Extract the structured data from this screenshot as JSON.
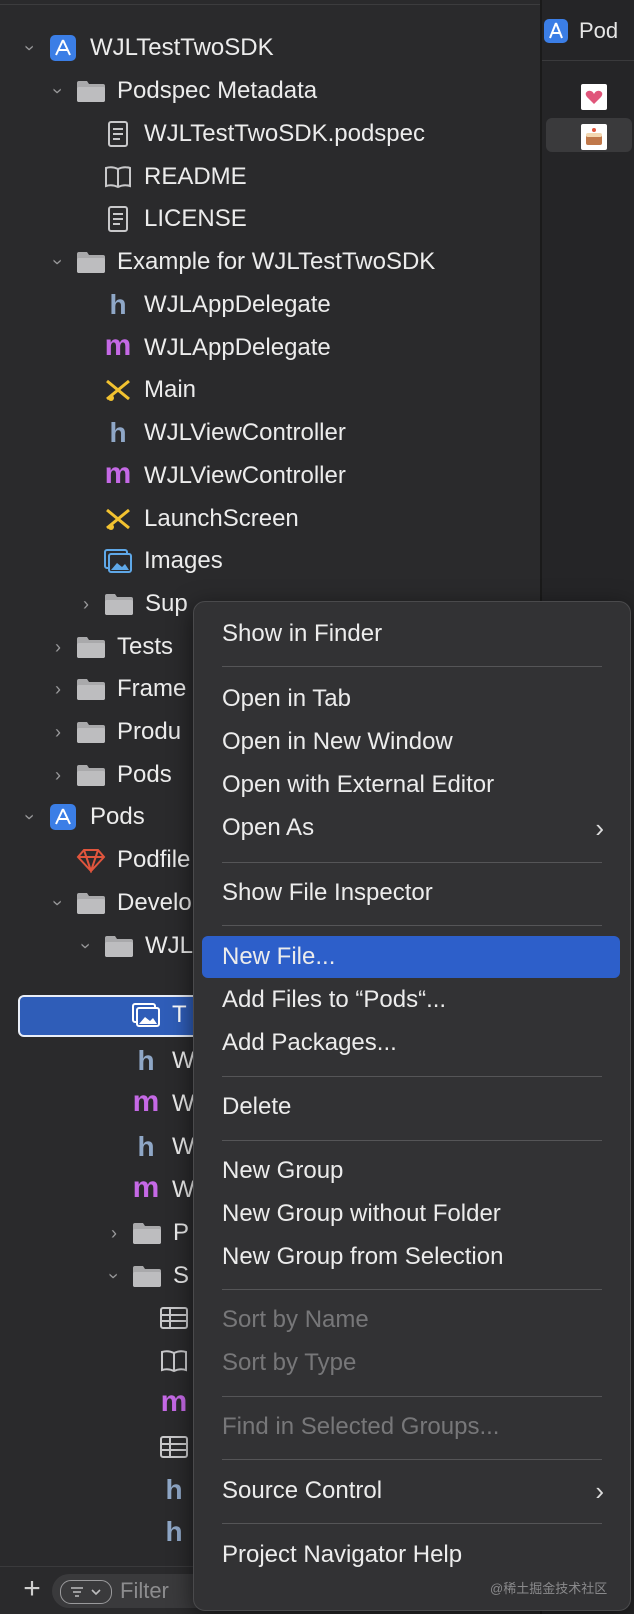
{
  "navigator": {
    "rows": [
      {
        "label": "WJLTestTwoSDK",
        "icon": "xcode-project-icon"
      },
      {
        "label": "Podspec Metadata",
        "icon": "folder-icon"
      },
      {
        "label": "WJLTestTwoSDK.podspec",
        "icon": "document-icon"
      },
      {
        "label": "README",
        "icon": "book-icon"
      },
      {
        "label": "LICENSE",
        "icon": "document-icon"
      },
      {
        "label": "Example for WJLTestTwoSDK",
        "icon": "folder-icon"
      },
      {
        "label": "WJLAppDelegate",
        "icon": "header-h-icon",
        "glyph": "h"
      },
      {
        "label": "WJLAppDelegate",
        "icon": "objc-m-icon",
        "glyph": "m"
      },
      {
        "label": "Main",
        "icon": "storyboard-icon"
      },
      {
        "label": "WJLViewController",
        "icon": "header-h-icon",
        "glyph": "h"
      },
      {
        "label": "WJLViewController",
        "icon": "objc-m-icon",
        "glyph": "m"
      },
      {
        "label": "LaunchScreen",
        "icon": "storyboard-icon"
      },
      {
        "label": "Images",
        "icon": "asset-catalog-icon"
      },
      {
        "label": "Sup",
        "icon": "folder-icon"
      },
      {
        "label": "Tests",
        "icon": "folder-icon"
      },
      {
        "label": "Frame",
        "icon": "folder-icon"
      },
      {
        "label": "Produ",
        "icon": "folder-icon"
      },
      {
        "label": "Pods",
        "icon": "folder-icon"
      },
      {
        "label": "Pods",
        "icon": "xcode-project-icon"
      },
      {
        "label": "Podfile",
        "icon": "ruby-icon"
      },
      {
        "label": "Develo",
        "icon": "folder-icon"
      },
      {
        "label": "WJL",
        "icon": "folder-icon"
      },
      {
        "label": "T",
        "icon": "asset-catalog-icon"
      },
      {
        "label": "W",
        "icon": "header-h-icon",
        "glyph": "h"
      },
      {
        "label": "W",
        "icon": "objc-m-icon",
        "glyph": "m"
      },
      {
        "label": "W",
        "icon": "header-h-icon",
        "glyph": "h"
      },
      {
        "label": "W",
        "icon": "objc-m-icon",
        "glyph": "m"
      },
      {
        "label": "P",
        "icon": "folder-icon"
      },
      {
        "label": "S",
        "icon": "folder-icon"
      },
      {
        "label": "",
        "icon": "table-icon"
      },
      {
        "label": "",
        "icon": "book-icon"
      },
      {
        "label": "",
        "icon": "objc-m-icon",
        "glyph": "m"
      },
      {
        "label": "",
        "icon": "table-icon"
      },
      {
        "label": "",
        "icon": "header-h-icon",
        "glyph": "h"
      },
      {
        "label": "",
        "icon": "header-h-icon",
        "glyph": "h"
      }
    ],
    "filter_placeholder": "Filter"
  },
  "right_pane": {
    "tab_label": "Pod"
  },
  "context_menu": {
    "items": [
      {
        "label": "Show in Finder"
      },
      {
        "label": "Open in Tab"
      },
      {
        "label": "Open in New Window"
      },
      {
        "label": "Open with External Editor"
      },
      {
        "label": "Open As",
        "submenu": true
      },
      {
        "label": "Show File Inspector"
      },
      {
        "label": "New File...",
        "highlighted": true
      },
      {
        "label": "Add Files to “Pods“..."
      },
      {
        "label": "Add Packages..."
      },
      {
        "label": "Delete"
      },
      {
        "label": "New Group"
      },
      {
        "label": "New Group without Folder"
      },
      {
        "label": "New Group from Selection"
      },
      {
        "label": "Sort by Name",
        "disabled": true
      },
      {
        "label": "Sort by Type",
        "disabled": true
      },
      {
        "label": "Find in Selected Groups...",
        "disabled": true
      },
      {
        "label": "Source Control",
        "submenu": true
      },
      {
        "label": "Project Navigator Help"
      }
    ]
  },
  "watermark": "@稀土掘金技术社区",
  "colors": {
    "background": "#2a2a2c",
    "menu_background": "#323234",
    "highlight": "#2d5fca",
    "selection": "#2f5db8",
    "header_h": "#8fa7c7",
    "objc_m": "#c569e6",
    "storyboard": "#f2c230",
    "ruby": "#e0553d",
    "project_blue": "#3b7ee6"
  }
}
